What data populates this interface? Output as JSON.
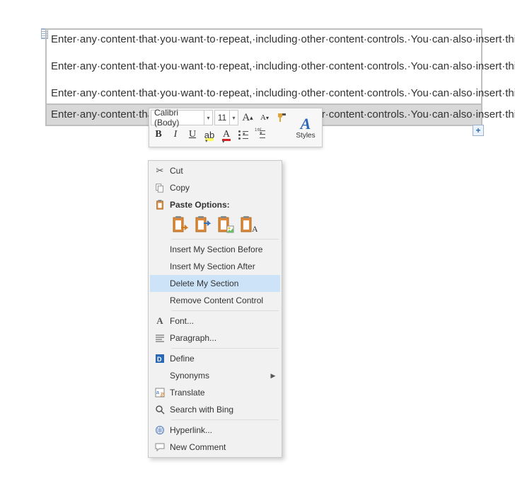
{
  "document": {
    "repeat_text": "Enter·any·content·that·you·want·to·repeat,·including·other·content·controls.·You·can·also·insert·this·control·around·table·rows·in·order·to·repeat·parts·of·a·table.¶",
    "add_button": "+"
  },
  "mini_toolbar": {
    "font_name": "Calibri (Body)",
    "font_size": "11",
    "styles_label": "Styles"
  },
  "context_menu": {
    "cut": "Cut",
    "copy": "Copy",
    "paste_options": "Paste Options:",
    "insert_before": "Insert My Section Before",
    "insert_after": "Insert My Section After",
    "delete_section": "Delete My Section",
    "remove_cc": "Remove Content Control",
    "font": "Font...",
    "paragraph": "Paragraph...",
    "define": "Define",
    "synonyms": "Synonyms",
    "translate": "Translate",
    "search_bing": "Search with Bing",
    "hyperlink": "Hyperlink...",
    "new_comment": "New Comment"
  }
}
